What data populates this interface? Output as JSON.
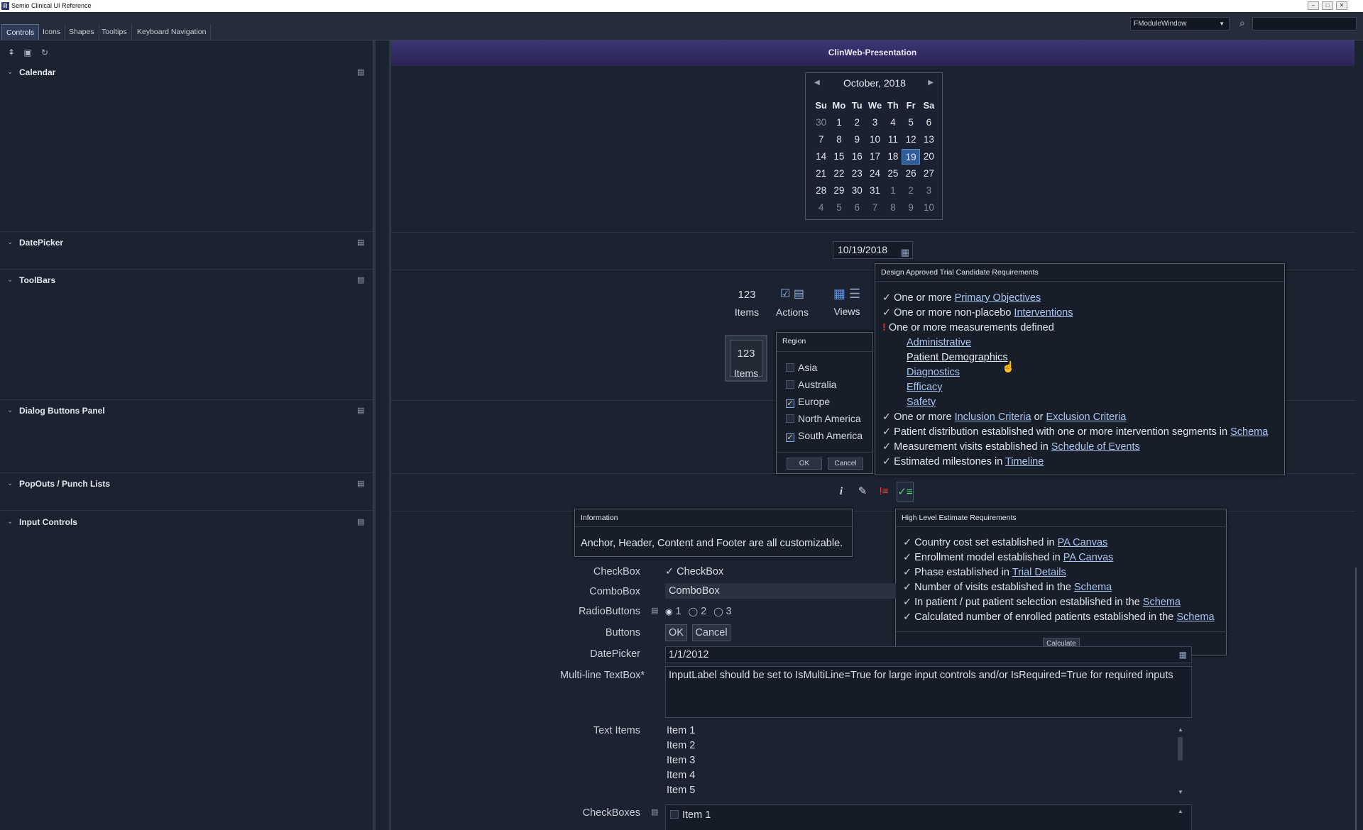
{
  "window": {
    "title": "Semio Clinical UI Reference",
    "app_icon": "R",
    "controls": [
      "–",
      "□",
      "✕"
    ]
  },
  "tabs": [
    "Controls",
    "Icons",
    "Shapes",
    "Tooltips",
    "Keyboard Navigation"
  ],
  "module_dropdown": {
    "value": "FModuleWindow"
  },
  "panel_title": "ClinWeb-Presentation",
  "sections": [
    "Calendar",
    "DatePicker",
    "ToolBars",
    "Dialog Buttons Panel",
    "PopOuts / Punch Lists",
    "Input Controls"
  ],
  "calendar": {
    "month": "October, 2018",
    "days_header": [
      "Su",
      "Mo",
      "Tu",
      "We",
      "Th",
      "Fr",
      "Sa"
    ],
    "weeks": [
      [
        "30",
        "1",
        "2",
        "3",
        "4",
        "5",
        "6"
      ],
      [
        "7",
        "8",
        "9",
        "10",
        "11",
        "12",
        "13"
      ],
      [
        "14",
        "15",
        "16",
        "17",
        "18",
        "19",
        "20"
      ],
      [
        "21",
        "22",
        "23",
        "24",
        "25",
        "26",
        "27"
      ],
      [
        "28",
        "29",
        "30",
        "31",
        "1",
        "2",
        "3"
      ],
      [
        "4",
        "5",
        "6",
        "7",
        "8",
        "9",
        "10"
      ]
    ],
    "selected": "19"
  },
  "datepicker": {
    "value": "10/19/2018"
  },
  "toolbar": {
    "count": "123",
    "items_label": "Items",
    "actions_label": "Actions",
    "views_label": "Views"
  },
  "toolbar2": {
    "count": "123",
    "items_label": "Items"
  },
  "region_popup": {
    "title": "Region",
    "items": [
      {
        "label": "Asia",
        "checked": false
      },
      {
        "label": "Australia",
        "checked": false
      },
      {
        "label": "Europe",
        "checked": true
      },
      {
        "label": "North America",
        "checked": false
      },
      {
        "label": "South America",
        "checked": true
      }
    ],
    "ok": "OK",
    "cancel": "Cancel"
  },
  "trial_popup": {
    "title": "Design Approved Trial Candidate Requirements",
    "l1a": "One or more ",
    "l1b": "Primary Objectives",
    "l2a": "One or more non-placebo ",
    "l2b": "Interventions",
    "l3a": "One or more measurements defined",
    "subs": [
      "Administrative",
      "Patient Demographics",
      "Diagnostics",
      "Efficacy",
      "Safety"
    ],
    "l4a": "One or more ",
    "l4b": "Inclusion Criteria",
    "l4c": " or ",
    "l4d": "Exclusion Criteria",
    "l5a": "Patient distribution established with one or more intervention segments in ",
    "l5b": "Schema",
    "l6a": "Measurement visits established in ",
    "l6b": "Schedule of Events",
    "l7a": "Estimated milestones in ",
    "l7b": "Timeline"
  },
  "info_popup": {
    "title": "Information",
    "text": "Anchor, Header, Content and Footer are all customizable."
  },
  "hl_popup": {
    "title": "High Level Estimate Requirements",
    "lines": [
      {
        "a": "Country cost set established in ",
        "b": "PA Canvas"
      },
      {
        "a": "Enrollment model established in ",
        "b": "PA Canvas"
      },
      {
        "a": "Phase established in ",
        "b": "Trial Details"
      },
      {
        "a": "Number of visits established in the ",
        "b": "Schema"
      },
      {
        "a": "In patient / put patient selection established in the ",
        "b": "Schema"
      },
      {
        "a": "Calculated number of enrolled patients established in the ",
        "b": "Schema"
      }
    ],
    "button": "Calculate"
  },
  "popout_buttons": [
    "i",
    "✎",
    "!≡",
    "✓≡"
  ],
  "inputs": {
    "checkbox_label": "CheckBox",
    "checkbox_text": "CheckBox",
    "combobox_label": "ComboBox",
    "combobox_value": "ComboBox",
    "radio_label": "RadioButtons",
    "radio_options": [
      "1",
      "2",
      "3"
    ],
    "buttons_label": "Buttons",
    "ok": "OK",
    "cancel": "Cancel",
    "datepicker_label": "DatePicker",
    "datepicker_value": "1/1/2012",
    "multiline_label": "Multi-line TextBox*",
    "multiline_value": "InputLabel should be set to IsMultiLine=True for large input controls and/or IsRequired=True for required inputs",
    "textitems_label": "Text Items",
    "textitems": [
      "Item 1",
      "Item 2",
      "Item 3",
      "Item 4",
      "Item 5"
    ],
    "checkboxes_label": "CheckBoxes",
    "checkboxes_first": "Item 1"
  }
}
